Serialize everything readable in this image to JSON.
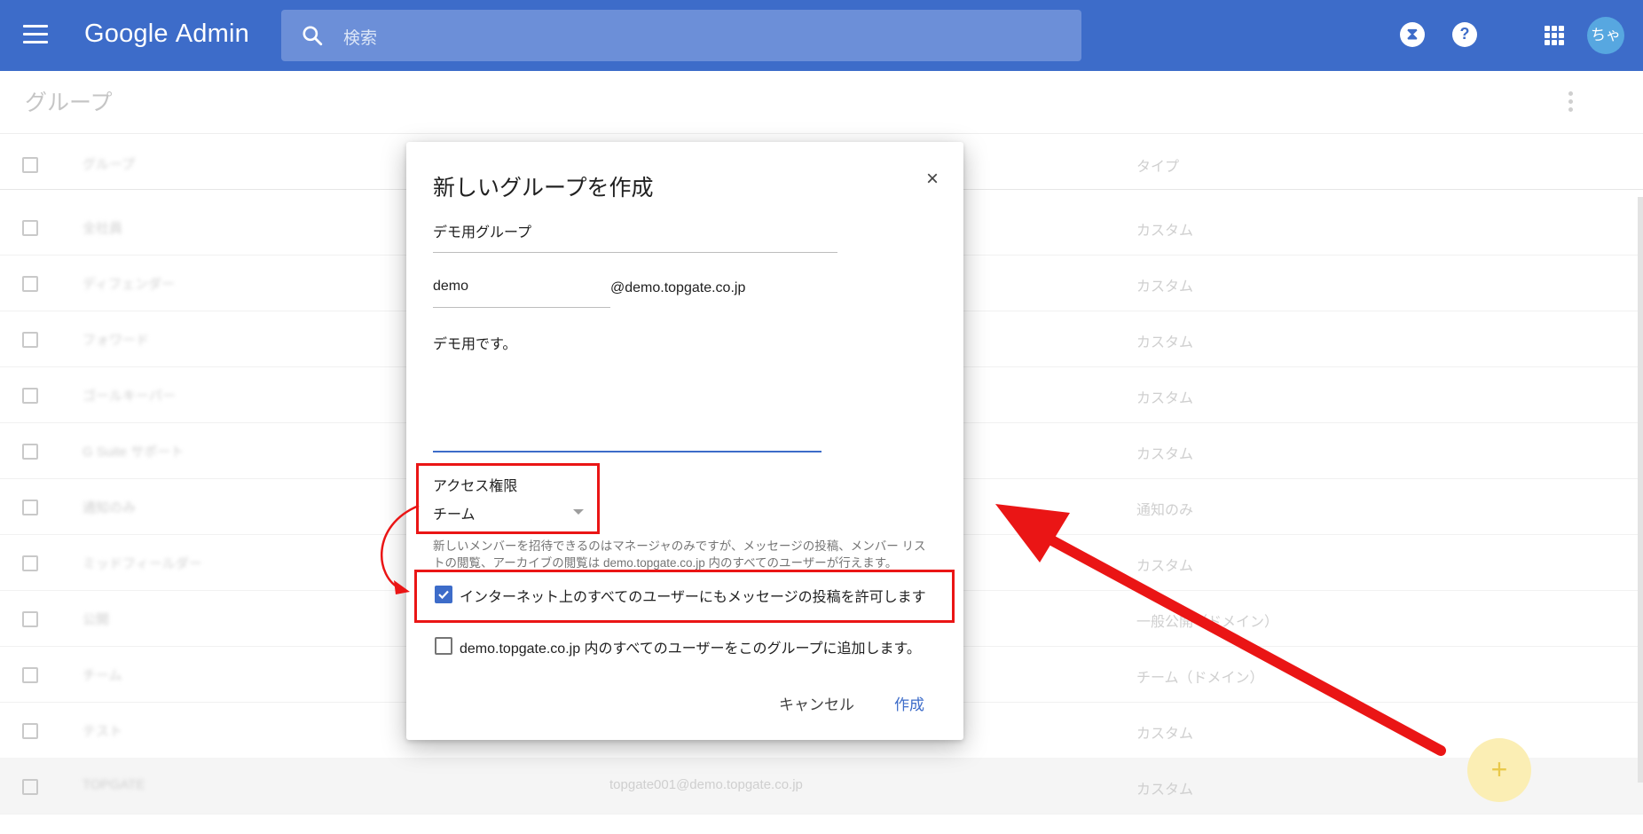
{
  "header": {
    "logo_brand": "Google",
    "logo_product": "Admin",
    "search_placeholder": "検索",
    "avatar_text": "ちゃ"
  },
  "page": {
    "title": "グループ"
  },
  "table": {
    "header_type": "タイプ",
    "rows": [
      {
        "type": "カスタム"
      },
      {
        "type": "カスタム"
      },
      {
        "type": "カスタム"
      },
      {
        "type": "カスタム"
      },
      {
        "type": "カスタム"
      },
      {
        "type": "通知のみ"
      },
      {
        "type": "カスタム"
      },
      {
        "type": "一般公開（ドメイン）"
      },
      {
        "type": "チーム（ドメイン）"
      },
      {
        "type": "カスタム"
      },
      {
        "type": "カスタム",
        "email": "topgate001@demo.topgate.co.jp"
      }
    ]
  },
  "dialog": {
    "title": "新しいグループを作成",
    "close": "×",
    "group_name": "デモ用グループ",
    "email_local": "demo",
    "email_domain": "@demo.topgate.co.jp",
    "description": "デモ用です。",
    "access_label": "アクセス権限",
    "access_value": "チーム",
    "help_text": "新しいメンバーを招待できるのはマネージャのみですが、メッセージの投稿、メンバー リストの閲覧、アーカイブの閲覧は demo.topgate.co.jp 内のすべてのユーザーが行えます。",
    "checkbox_internet": {
      "label": "インターネット上のすべてのユーザーにもメッセージの投稿を許可します",
      "checked": true
    },
    "checkbox_add_all": {
      "label": "demo.topgate.co.jp 内のすべてのユーザーをこのグループに追加します。",
      "checked": false
    },
    "cancel_label": "キャンセル",
    "create_label": "作成"
  },
  "colors": {
    "header": "#3d6cc9",
    "accent": "#3d6cc9",
    "annotation": "#ea1515"
  }
}
